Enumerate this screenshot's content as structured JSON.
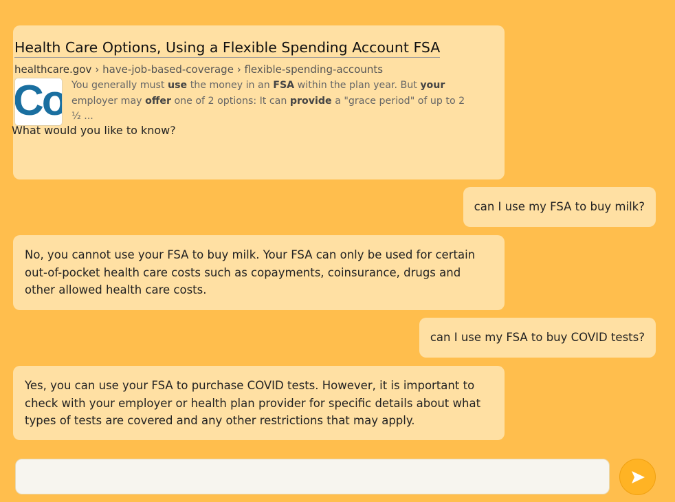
{
  "messages": {
    "search_result": {
      "title": "Health Care Options, Using a Flexible Spending Account FSA",
      "domain": "healthcare.gov",
      "path": "› have-job-based-coverage › flexible-spending-accounts",
      "thumbnail_text": "Co",
      "snippet": {
        "p1": "You generally must ",
        "b1": "use",
        "p2": " the money in an ",
        "b2": "FSA",
        "p3": " within the plan year. But ",
        "b3": "your",
        "p4": " employer may ",
        "b4": "offer",
        "p5": " one of 2 options: It can ",
        "b5": "provide",
        "p6": " a \"grace period\" of up to 2 ½ ..."
      },
      "prompt": "What would you like to know?"
    },
    "user_1": "can I use my FSA to buy milk?",
    "bot_1": "No, you cannot use your FSA to buy milk. Your FSA can only be used for certain out-of-pocket health care costs such as copayments, coinsurance, drugs and other allowed health care costs.",
    "user_2": "can I use my FSA to buy COVID tests?",
    "bot_2": "Yes, you can use your FSA to purchase COVID tests. However, it is important to check with your employer or health plan provider for specific details about what types of tests are covered and any other restrictions that may apply."
  },
  "composer": {
    "value": "",
    "placeholder": ""
  },
  "send_button": {
    "icon": "send-arrow-icon"
  },
  "colors": {
    "background": "#ffbe4d",
    "bubble": "#ffe0a3",
    "send_button": "#ffb324",
    "thumbnail_logo": "#1a6fa0"
  }
}
